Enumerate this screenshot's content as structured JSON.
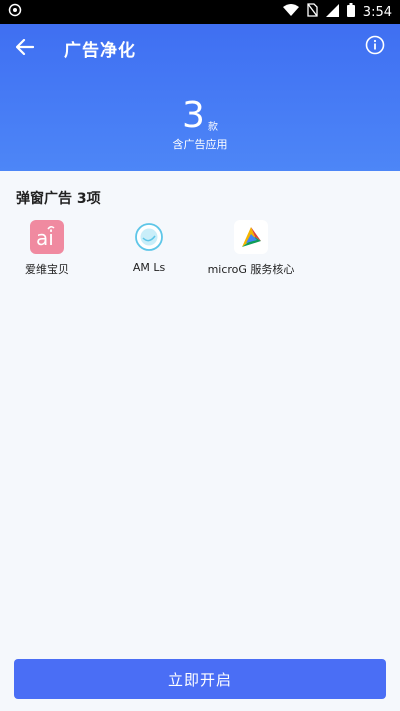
{
  "status_bar": {
    "time": "3:54",
    "icons": [
      "target-icon",
      "wifi-icon",
      "no-sim-icon",
      "signal-icon",
      "battery-icon"
    ]
  },
  "header": {
    "title": "广告净化",
    "count": "3",
    "count_unit": "款",
    "count_caption": "含广告应用",
    "background": "#4c7ff6"
  },
  "section": {
    "title": "弹窗广告 3项"
  },
  "apps": [
    {
      "label": "爱维宝贝",
      "icon": "aiweibaobei-app-icon"
    },
    {
      "label": "AM Ls",
      "icon": "am-ls-app-icon"
    },
    {
      "label": "microG 服务核心",
      "icon": "microg-app-icon"
    }
  ],
  "cta": {
    "label": "立即开启",
    "color": "#4a6ef5"
  }
}
